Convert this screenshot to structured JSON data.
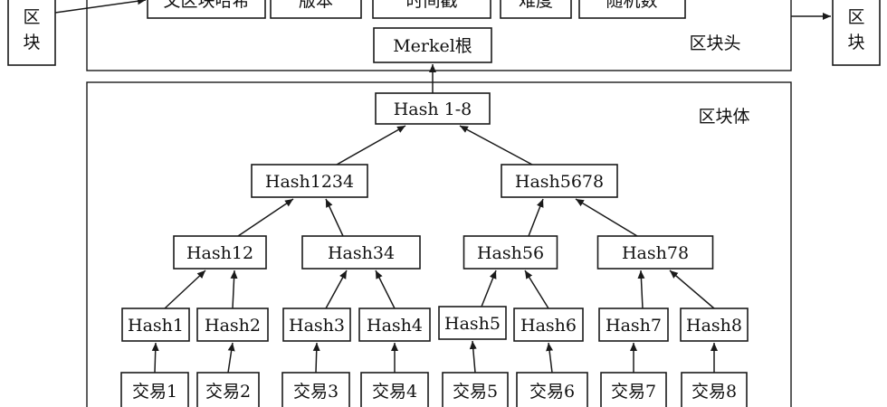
{
  "header": {
    "label": "区块头",
    "fields": [
      "父区块哈希",
      "版本",
      "时间戳",
      "难度",
      "随机数"
    ],
    "merkle_root": "Merkel根"
  },
  "body": {
    "label": "区块体",
    "root": "Hash 1-8",
    "level2": [
      "Hash1234",
      "Hash5678"
    ],
    "level3": [
      "Hash12",
      "Hash34",
      "Hash56",
      "Hash78"
    ],
    "leaf_hashes": [
      "Hash1",
      "Hash2",
      "Hash3",
      "Hash4",
      "Hash5",
      "Hash6",
      "Hash7",
      "Hash8"
    ],
    "transactions": [
      "交易1",
      "交易2",
      "交易3",
      "交易4",
      "交易5",
      "交易6",
      "交易7",
      "交易8"
    ]
  },
  "chain": {
    "prev_block_label": "区\n块",
    "next_block_label": "区\n块"
  },
  "colors": {
    "stroke": "#1a1a1a",
    "background": "#ffffff",
    "text": "#111111"
  }
}
